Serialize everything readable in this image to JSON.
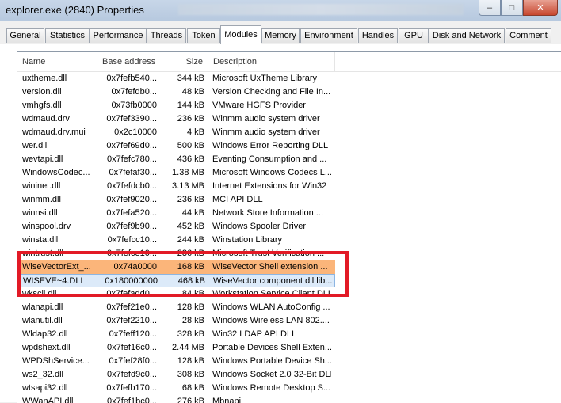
{
  "window": {
    "title": "explorer.exe (2840) Properties"
  },
  "tabs": [
    {
      "label": "General",
      "active": false
    },
    {
      "label": "Statistics",
      "active": false
    },
    {
      "label": "Performance",
      "active": false
    },
    {
      "label": "Threads",
      "active": false
    },
    {
      "label": "Token",
      "active": false
    },
    {
      "label": "Modules",
      "active": true
    },
    {
      "label": "Memory",
      "active": false
    },
    {
      "label": "Environment",
      "active": false
    },
    {
      "label": "Handles",
      "active": false
    },
    {
      "label": "GPU",
      "active": false
    },
    {
      "label": "Disk and Network",
      "active": false
    },
    {
      "label": "Comment",
      "active": false
    }
  ],
  "modules": {
    "columns": [
      "Name",
      "Base address",
      "Size",
      "Description"
    ],
    "rows": [
      {
        "name": "uxtheme.dll",
        "base": "0x7fefb540...",
        "size": "344 kB",
        "desc": "Microsoft UxTheme Library"
      },
      {
        "name": "version.dll",
        "base": "0x7fefdb0...",
        "size": "48 kB",
        "desc": "Version Checking and File In..."
      },
      {
        "name": "vmhgfs.dll",
        "base": "0x73fb0000",
        "size": "144 kB",
        "desc": "VMware HGFS Provider"
      },
      {
        "name": "wdmaud.drv",
        "base": "0x7fef3390...",
        "size": "236 kB",
        "desc": "Winmm  audio system driver"
      },
      {
        "name": "wdmaud.drv.mui",
        "base": "0x2c10000",
        "size": "4 kB",
        "desc": "Winmm  audio system driver"
      },
      {
        "name": "wer.dll",
        "base": "0x7fef69d0...",
        "size": "500 kB",
        "desc": "Windows Error Reporting DLL"
      },
      {
        "name": "wevtapi.dll",
        "base": "0x7fefc780...",
        "size": "436 kB",
        "desc": "Eventing Consumption and ..."
      },
      {
        "name": "WindowsCodec...",
        "base": "0x7fefaf30...",
        "size": "1.38 MB",
        "desc": "Microsoft Windows Codecs L..."
      },
      {
        "name": "wininet.dll",
        "base": "0x7fefdcb0...",
        "size": "3.13 MB",
        "desc": "Internet Extensions for Win32"
      },
      {
        "name": "winmm.dll",
        "base": "0x7fef9020...",
        "size": "236 kB",
        "desc": "MCI API DLL"
      },
      {
        "name": "winnsi.dll",
        "base": "0x7fefa520...",
        "size": "44 kB",
        "desc": "Network Store Information ..."
      },
      {
        "name": "winspool.drv",
        "base": "0x7fef9b90...",
        "size": "452 kB",
        "desc": "Windows Spooler Driver"
      },
      {
        "name": "winsta.dll",
        "base": "0x7fefcc10...",
        "size": "244 kB",
        "desc": "Winstation Library"
      },
      {
        "name": "wintrust.dll",
        "base": "0x7fefce10...",
        "size": "236 kB",
        "desc": "Microsoft Trust Verification ..."
      },
      {
        "name": "WiseVectorExt_...",
        "base": "0x74a0000",
        "size": "168 kB",
        "desc": "WiseVector Shell extension ...",
        "highlight": "orange"
      },
      {
        "name": "WISEVE~4.DLL",
        "base": "0x180000000",
        "size": "468 kB",
        "desc": "WiseVector component dll lib...",
        "highlight": "blue"
      },
      {
        "name": "wkscli.dll",
        "base": "0x7fefadd0...",
        "size": "84 kB",
        "desc": "Workstation Service Client DLL"
      },
      {
        "name": "wlanapi.dll",
        "base": "0x7fef21e0...",
        "size": "128 kB",
        "desc": "Windows WLAN AutoConfig ..."
      },
      {
        "name": "wlanutil.dll",
        "base": "0x7fef2210...",
        "size": "28 kB",
        "desc": "Windows Wireless LAN 802...."
      },
      {
        "name": "Wldap32.dll",
        "base": "0x7feff120...",
        "size": "328 kB",
        "desc": "Win32 LDAP API DLL"
      },
      {
        "name": "wpdshext.dll",
        "base": "0x7fef16c0...",
        "size": "2.44 MB",
        "desc": "Portable Devices Shell Exten..."
      },
      {
        "name": "WPDShService...",
        "base": "0x7fef28f0...",
        "size": "128 kB",
        "desc": "Windows Portable Device Sh..."
      },
      {
        "name": "ws2_32.dll",
        "base": "0x7fefd9c0...",
        "size": "308 kB",
        "desc": "Windows Socket 2.0 32-Bit DLL"
      },
      {
        "name": "wtsapi32.dll",
        "base": "0x7fefb170...",
        "size": "68 kB",
        "desc": "Windows Remote Desktop S..."
      },
      {
        "name": "WWanAPI.dll",
        "base": "0x7fef1bc0...",
        "size": "276 kB",
        "desc": "Mbnapi"
      }
    ]
  }
}
